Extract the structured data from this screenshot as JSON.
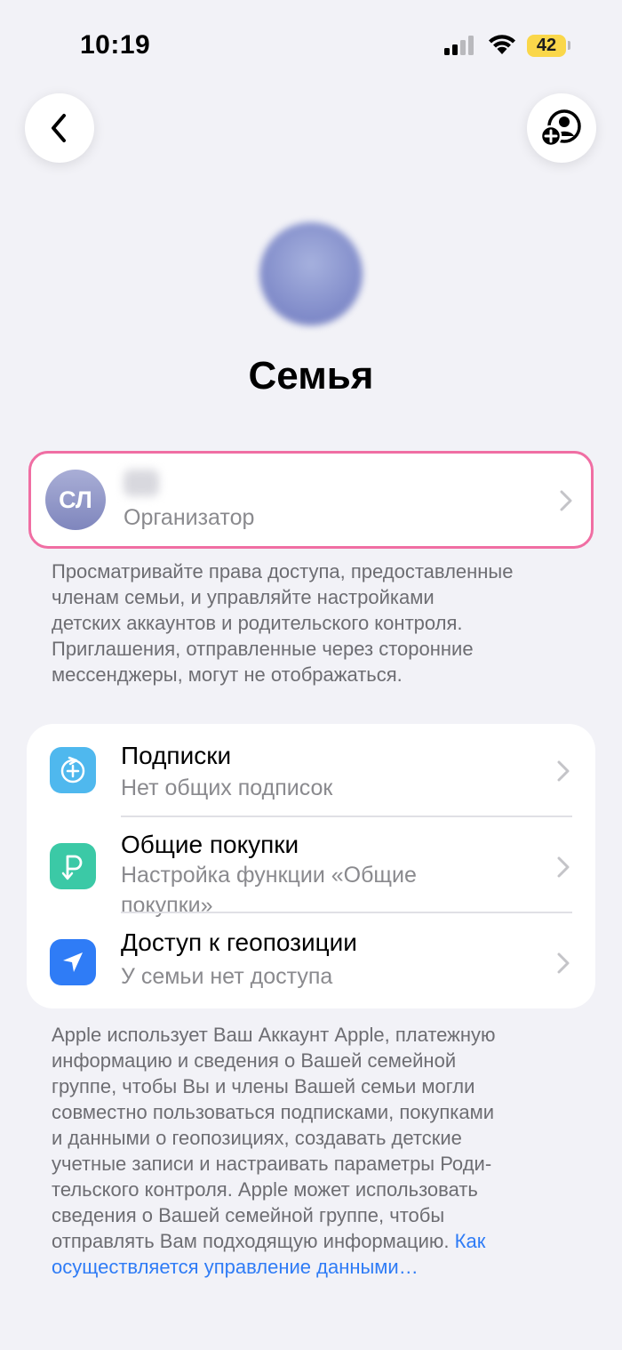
{
  "status_bar": {
    "time": "10:19",
    "battery": "42"
  },
  "header": {
    "title": "Семья"
  },
  "organizer": {
    "initials": "СЛ",
    "role": "Организатор"
  },
  "organizer_description": "Просматривайте права доступа, предоставленные\nчленам семьи, и управляйте настройками\nдетских аккаунтов и родительского контроля.\nПриглашения, отправленные через сторонние\nмессенджеры, могут не отображаться.",
  "features": [
    {
      "title": "Подписки",
      "subtitle": "Нет общих подписок",
      "icon": "subscriptions-icon",
      "color": "#4fb8ee"
    },
    {
      "title": "Общие покупки",
      "subtitle": "Настройка функции «Общие\nпокупки»",
      "icon": "purchase-sharing-icon",
      "color": "#3bc9a6"
    },
    {
      "title": "Доступ к геопозиции",
      "subtitle": "У семьи нет доступа",
      "icon": "location-icon",
      "color": "#2f7cf6"
    }
  ],
  "privacy_text": "Apple использует Ваш Аккаунт Apple, платежную\nинформацию и сведения о Вашей семейной\nгруппе, чтобы Вы и члены Вашей семьи могли\nсовместно пользоваться подписками, покупками\nи данными о геопозициях, создавать детские\nучетные записи и настраивать параметры Роди-\nтельского контроля. Apple может использовать\nсведения о Вашей семейной группе, чтобы\nотправлять Вам подходящую информацию.",
  "privacy_link": "Как\nосуществляется управление данными…"
}
